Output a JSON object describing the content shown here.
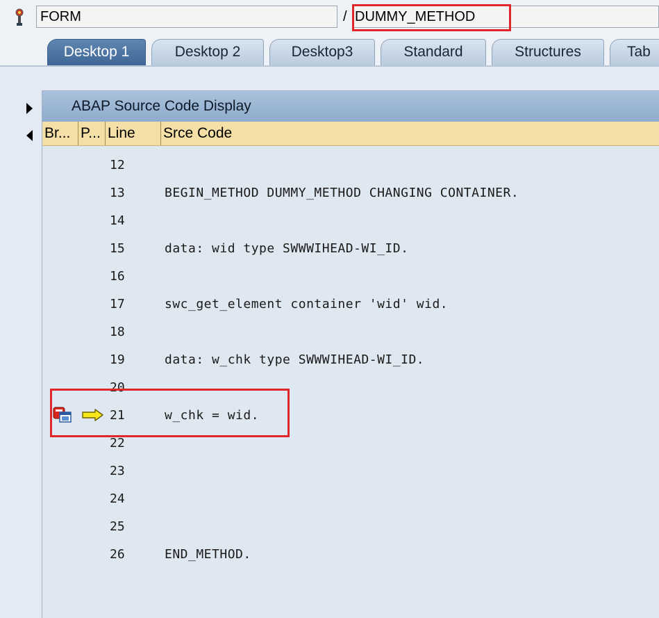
{
  "header": {
    "form_value": "FORM",
    "separator": "/",
    "method_value": "DUMMY_METHOD",
    "highlight_color": "#e0262b"
  },
  "tabs": [
    {
      "label": "Desktop 1",
      "active": true
    },
    {
      "label": "Desktop 2",
      "active": false
    },
    {
      "label": "Desktop3",
      "active": false
    },
    {
      "label": "Standard",
      "active": false
    },
    {
      "label": "Structures",
      "active": false
    },
    {
      "label": "Tab",
      "active": false
    }
  ],
  "panel": {
    "title": "ABAP Source Code Display",
    "columns": [
      "Br...",
      "P...",
      "Line",
      "Srce Code"
    ]
  },
  "code": [
    {
      "line": "12",
      "text": ""
    },
    {
      "line": "13",
      "text": "BEGIN_METHOD DUMMY_METHOD CHANGING CONTAINER."
    },
    {
      "line": "14",
      "text": ""
    },
    {
      "line": "15",
      "text": "data: wid type SWWWIHEAD-WI_ID."
    },
    {
      "line": "16",
      "text": ""
    },
    {
      "line": "17",
      "text": "swc_get_element container 'wid' wid."
    },
    {
      "line": "18",
      "text": ""
    },
    {
      "line": "19",
      "text": "data: w_chk type SWWWIHEAD-WI_ID."
    },
    {
      "line": "20",
      "text": ""
    },
    {
      "line": "21",
      "text": "w_chk = wid."
    },
    {
      "line": "22",
      "text": ""
    },
    {
      "line": "23",
      "text": ""
    },
    {
      "line": "24",
      "text": ""
    },
    {
      "line": "25",
      "text": ""
    },
    {
      "line": "26",
      "text": "END_METHOD."
    }
  ],
  "icons": {
    "settings": "settings-icon",
    "breakpoint": "breakpoint-icon",
    "execution_pointer": "arrow-right-icon"
  }
}
